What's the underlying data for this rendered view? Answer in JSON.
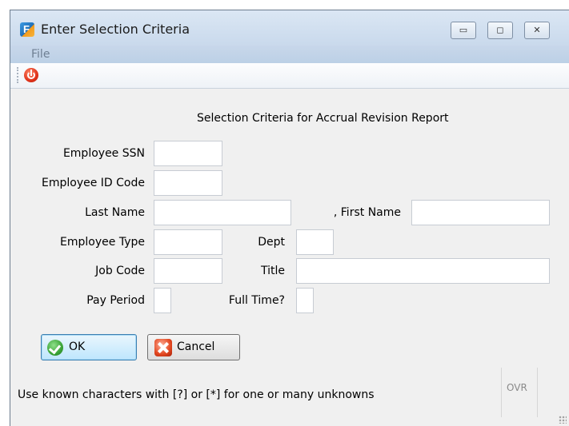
{
  "window": {
    "title": "Enter Selection Criteria",
    "app_icon": "app-logo-icon",
    "controls": {
      "minimize": "minimize-icon",
      "maximize": "maximize-icon",
      "close": "close-icon"
    }
  },
  "menu": {
    "items": [
      {
        "label": "File"
      }
    ]
  },
  "toolbar": {
    "items": [
      {
        "icon": "power-icon"
      }
    ]
  },
  "form": {
    "heading": "Selection Criteria for Accrual Revision Report",
    "fields": {
      "employee_ssn": {
        "label": "Employee SSN",
        "value": ""
      },
      "employee_id_code": {
        "label": "Employee ID Code",
        "value": ""
      },
      "last_name": {
        "label": "Last Name",
        "value": ""
      },
      "first_name": {
        "label": ", First Name",
        "value": ""
      },
      "employee_type": {
        "label": "Employee Type",
        "value": ""
      },
      "dept": {
        "label": "Dept",
        "value": ""
      },
      "job_code": {
        "label": "Job Code",
        "value": ""
      },
      "title": {
        "label": "Title",
        "value": ""
      },
      "pay_period": {
        "label": "Pay Period",
        "value": ""
      },
      "full_time": {
        "label": "Full Time?",
        "value": ""
      }
    }
  },
  "buttons": {
    "ok": {
      "label": "OK",
      "icon": "check-icon"
    },
    "cancel": {
      "label": "Cancel",
      "icon": "cancel-x-icon"
    }
  },
  "status": {
    "text": "Use known characters with [?] or [*] for one or many unknowns",
    "mode": "OVR"
  },
  "colors": {
    "accent": "#3c7fb1",
    "titlebar": "#c9d9ec",
    "background": "#f0f0f0"
  }
}
